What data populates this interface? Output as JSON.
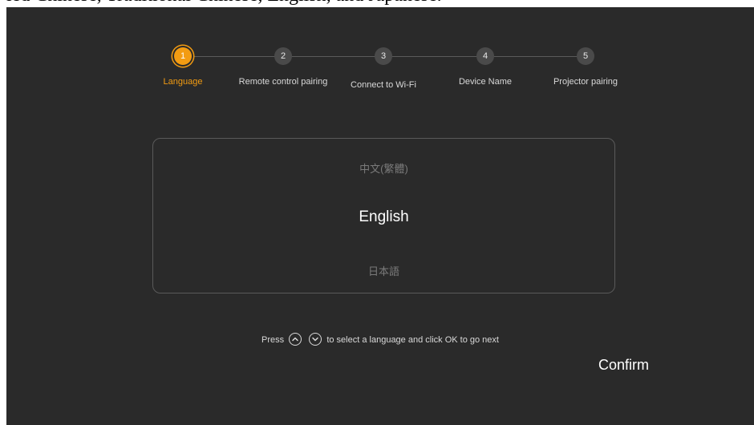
{
  "caption": "ied Chinese, Traditional Chinese, English, and Japanese.",
  "steps": [
    {
      "number": "1",
      "label": "Language"
    },
    {
      "number": "2",
      "label": "Remote control pairing"
    },
    {
      "number": "3",
      "label": "Connect to Wi-Fi"
    },
    {
      "number": "4",
      "label": "Device Name"
    },
    {
      "number": "5",
      "label": "Projector pairing"
    }
  ],
  "active_step": 1,
  "colors": {
    "accent": "#f39c12",
    "background": "#2a2a2a"
  },
  "languages": {
    "prev": "中文(繁體)",
    "selected": "English",
    "next": "日本語"
  },
  "hint": {
    "before": "Press",
    "up_icon": "chevron-up-circle-icon",
    "down_icon": "chevron-down-circle-icon",
    "after": "to select a language and click OK to go next"
  },
  "confirm_label": "Confirm"
}
